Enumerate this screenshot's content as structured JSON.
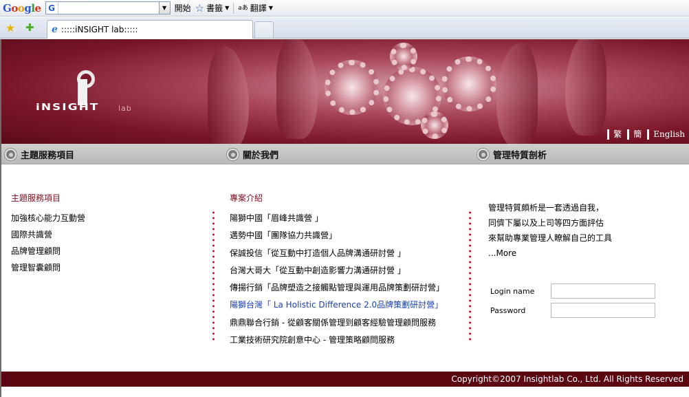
{
  "browser": {
    "google_logo": [
      "G",
      "o",
      "o",
      "g",
      "l",
      "e"
    ],
    "search_value": "",
    "search_g": "G",
    "start_label": "開始",
    "bookmarks_label": "書籤",
    "translate_label": "翻譯",
    "tab_title": ":::::iNSIGHT lab:::::"
  },
  "banner": {
    "logo_main": "iNSIGHT",
    "logo_sub": "lab",
    "languages": [
      "繁",
      "簡",
      "English"
    ]
  },
  "sections": {
    "services_title": "主題服務項目",
    "about_title": "關於我們",
    "analysis_title": "管理特質剖析"
  },
  "services": {
    "heading": "主題服務項目",
    "items": [
      "加強核心能力互動營",
      "國際共識營",
      "品牌管理顧問",
      "管理智囊顧問"
    ]
  },
  "projects": {
    "heading": "專案介紹",
    "items": [
      "陽獅中國「眉峰共識營 」",
      "邁勢中國「團隊協力共識營」",
      "保誠投信「從互動中打造個人品牌溝通研討營 」",
      "台灣大哥大「從互動中創造影響力溝通研討營 」",
      "傳揚行銷「品牌塑造之接觸點管理與運用品牌策劃研討營」",
      "陽獅台灣「 La Holistic Difference 2.0品牌策劃研討營」",
      "鼎鼎聯合行銷 - 從顧客關係管理到顧客經驗管理顧問服務",
      "工業技術研究院創意中心 - 管理策略顧問服務"
    ]
  },
  "analysis": {
    "lines": [
      "管理特質頗析是一套透過自我，",
      "同儕下屬以及上司等四方面評估",
      "來幫助專業管理人瞭解自己的工具"
    ],
    "more": "...More"
  },
  "login": {
    "name_label": "Login name",
    "password_label": "Password",
    "name_value": "",
    "password_value": ""
  },
  "footer": {
    "copyright": "Copyright©2007 Insightlab Co., Ltd. All Rights Reserved"
  }
}
